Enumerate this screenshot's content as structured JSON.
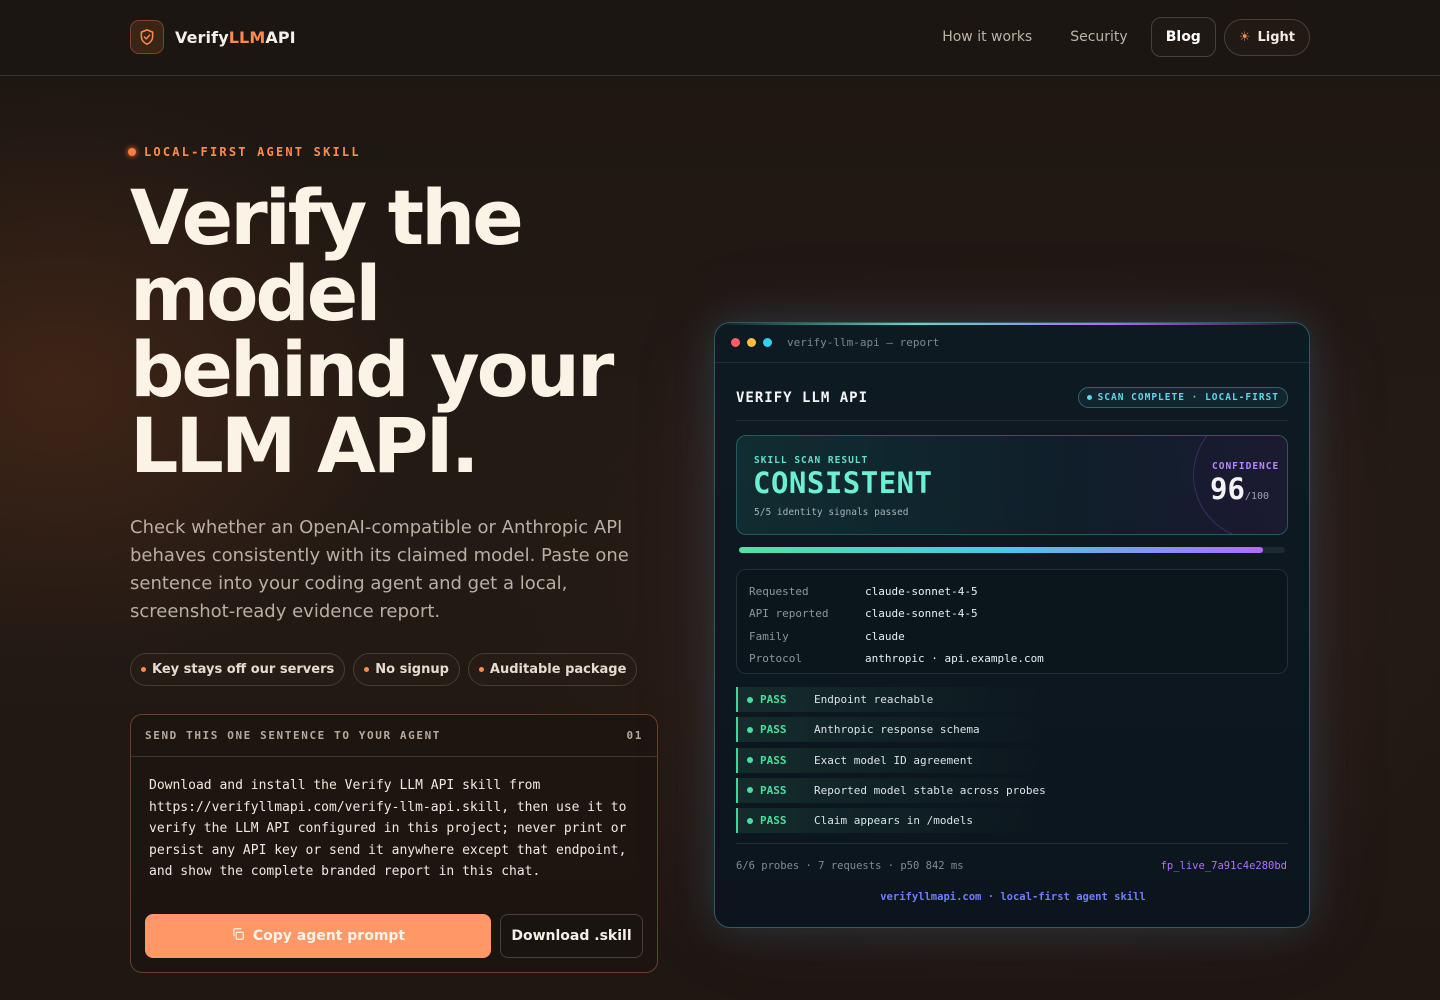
{
  "header": {
    "brand_prefix": "Verify",
    "brand_accent": "LLM",
    "brand_suffix": "API",
    "nav": {
      "how": "How it works",
      "security": "Security",
      "blog": "Blog",
      "theme": "Light"
    }
  },
  "hero": {
    "eyebrow": "LOCAL-FIRST AGENT SKILL",
    "title": "Verify the model behind your LLM API.",
    "subtitle": "Check whether an OpenAI-compatible or Anthropic API behaves consistently with its claimed model. Paste one sentence into your coding agent and get a local, screenshot-ready evidence report.",
    "chips": [
      "Key stays off our servers",
      "No signup",
      "Auditable package"
    ]
  },
  "prompt": {
    "heading": "SEND THIS ONE SENTENCE TO YOUR AGENT",
    "index": "01",
    "text": "Download and install the Verify LLM API skill from https://verifyllmapi.com/verify-llm-api.skill, then use it to verify the LLM API configured in this project; never print or persist any API key or send it anywhere except that endpoint, and show the complete branded report in this chat.",
    "copy_button": "Copy agent prompt",
    "download_button": "Download .skill"
  },
  "report": {
    "window_title": "verify-llm-api — report",
    "name": "VERIFY LLM API",
    "badge": "SCAN COMPLETE · LOCAL-FIRST",
    "result_label": "SKILL SCAN RESULT",
    "result_value": "CONSISTENT",
    "result_detail": "5/5 identity signals passed",
    "confidence_label": "CONFIDENCE",
    "confidence_value": "96",
    "confidence_max": "/100",
    "confidence_fraction": 0.96,
    "meta": [
      {
        "key": "Requested",
        "value": "claude-sonnet-4-5"
      },
      {
        "key": "API reported",
        "value": "claude-sonnet-4-5"
      },
      {
        "key": "Family",
        "value": "claude"
      },
      {
        "key": "Protocol",
        "value": "anthropic · api.example.com"
      }
    ],
    "checks": [
      {
        "status": "PASS",
        "text": "Endpoint reachable"
      },
      {
        "status": "PASS",
        "text": "Anthropic response schema"
      },
      {
        "status": "PASS",
        "text": "Exact model ID agreement"
      },
      {
        "status": "PASS",
        "text": "Reported model stable across probes"
      },
      {
        "status": "PASS",
        "text": "Claim appears in /models"
      }
    ],
    "stats": "6/6 probes · 7 requests · p50 842 ms",
    "fingerprint": "fp_live_7a91c4e280bd",
    "footer": "verifyllmapi.com · local-first agent skill"
  },
  "colors": {
    "accent": "#ff8a4c",
    "copy_button": "#ff9766",
    "pass": "#46e0a0",
    "result": "#6df0d2",
    "fingerprint": "#b470ff"
  }
}
